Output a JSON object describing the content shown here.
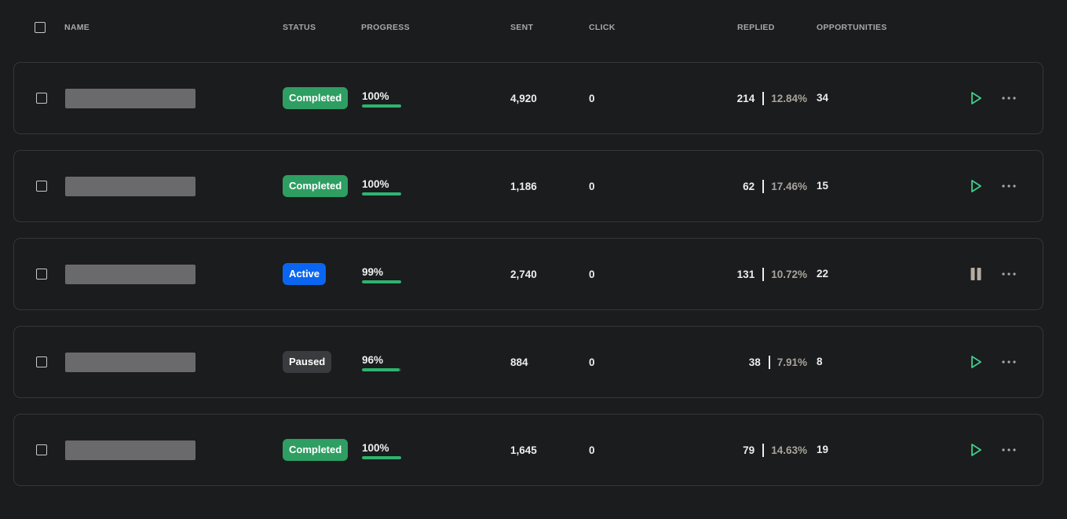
{
  "header": {
    "name": "NAME",
    "status": "STATUS",
    "progress": "PROGRESS",
    "sent": "SENT",
    "click": "CLICK",
    "replied": "REPLIED",
    "opportunities": "OPPORTUNITIES"
  },
  "colors": {
    "completed": "#2e9e62",
    "active": "#0a66f0",
    "paused": "#3a3b3e",
    "play_icon": "#3fcf8e",
    "pause_icon": "#b4aca0"
  },
  "rows": [
    {
      "status": "Completed",
      "status_key": "completed",
      "progress": "100%",
      "progress_value": 100,
      "sent": "4,920",
      "click": "0",
      "replied": "214",
      "reply_rate": "12.84%",
      "opportunities": "34",
      "action_icon": "play-icon"
    },
    {
      "status": "Completed",
      "status_key": "completed",
      "progress": "100%",
      "progress_value": 100,
      "sent": "1,186",
      "click": "0",
      "replied": "62",
      "reply_rate": "17.46%",
      "opportunities": "15",
      "action_icon": "play-icon"
    },
    {
      "status": "Active",
      "status_key": "active",
      "progress": "99%",
      "progress_value": 99,
      "sent": "2,740",
      "click": "0",
      "replied": "131",
      "reply_rate": "10.72%",
      "opportunities": "22",
      "action_icon": "pause-icon"
    },
    {
      "status": "Paused",
      "status_key": "paused",
      "progress": "96%",
      "progress_value": 96,
      "sent": "884",
      "click": "0",
      "replied": "38",
      "reply_rate": "7.91%",
      "opportunities": "8",
      "action_icon": "play-icon"
    },
    {
      "status": "Completed",
      "status_key": "completed",
      "progress": "100%",
      "progress_value": 100,
      "sent": "1,645",
      "click": "0",
      "replied": "79",
      "reply_rate": "14.63%",
      "opportunities": "19",
      "action_icon": "play-icon"
    }
  ]
}
